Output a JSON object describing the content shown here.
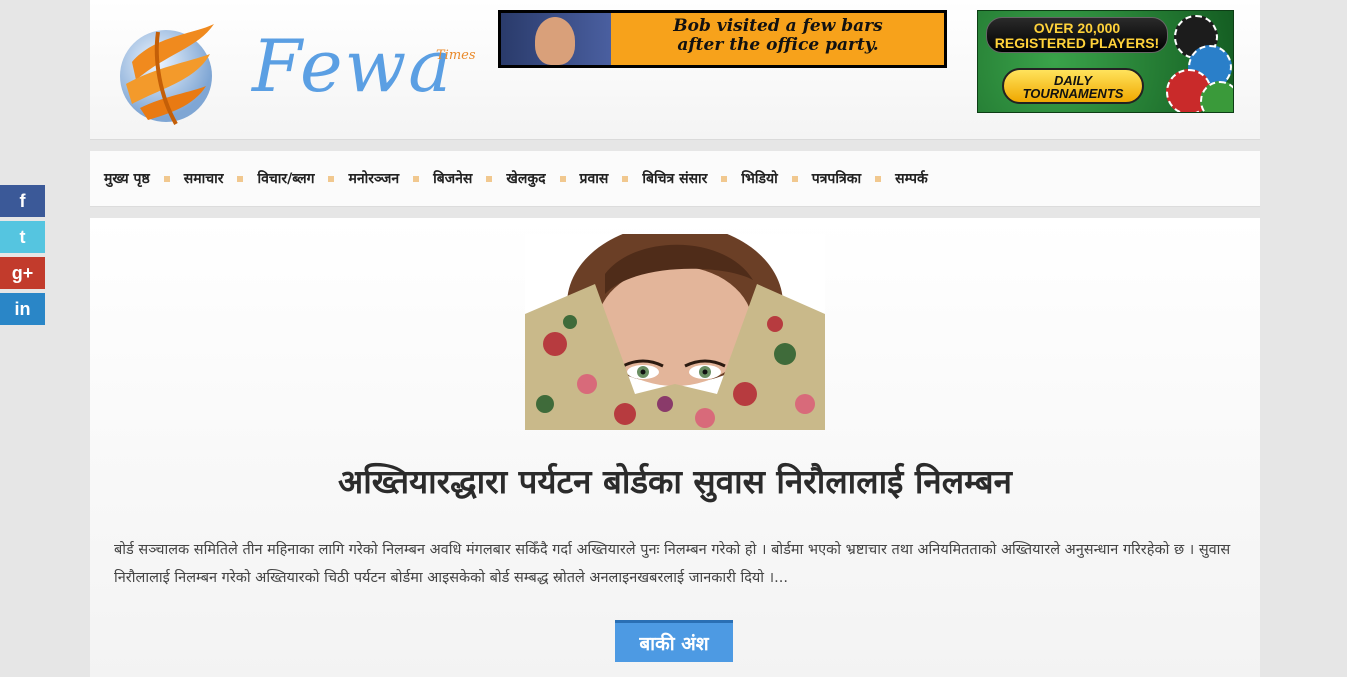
{
  "header": {
    "logo_word": "Fewa",
    "logo_sub": "Times",
    "ad_left": {
      "line1": "Bob visited a few bars",
      "line2": "after the office party."
    },
    "ad_right": {
      "line1": "OVER 20,000",
      "line2": "REGISTERED PLAYERS!",
      "btn1": "DAILY",
      "btn2": "TOURNAMENTS"
    }
  },
  "nav": {
    "items": [
      "मुख्य पृष्ठ",
      "समाचार",
      "विचार/ब्लग",
      "मनोरञ्जन",
      "बिजनेस",
      "खेलकुद",
      "प्रवास",
      "बिचित्र संसार",
      "भिडियो",
      "पत्रपत्रिका",
      "सम्पर्क"
    ]
  },
  "article": {
    "headline": "अख्तियारद्धारा पर्यटन बोर्डका सुवास निरौलालाई निलम्बन",
    "excerpt": "बोर्ड सञ्चालक समितिले तीन महिनाका लागि गरेको निलम्बन अवधि मंगलबार सकिँदै गर्दा अख्तियारले पुनः निलम्बन गरेको हो । बोर्डमा भएको भ्रष्टाचार तथा अनियमितताको अख्तियारले अनुसन्धान गरिरहेको छ । सुवास निरौलालाई निलम्बन गरेको अख्तियारको चिठी पर्यटन बोर्डमा आइसकेको बोर्ड सम्बद्ध स्रोतले अनलाइनखबरलाई जानकारी दियो ।...",
    "read_more": "बाकी अंश"
  },
  "social": {
    "facebook": "f",
    "twitter": "t",
    "googleplus": "g+",
    "linkedin": "in"
  }
}
